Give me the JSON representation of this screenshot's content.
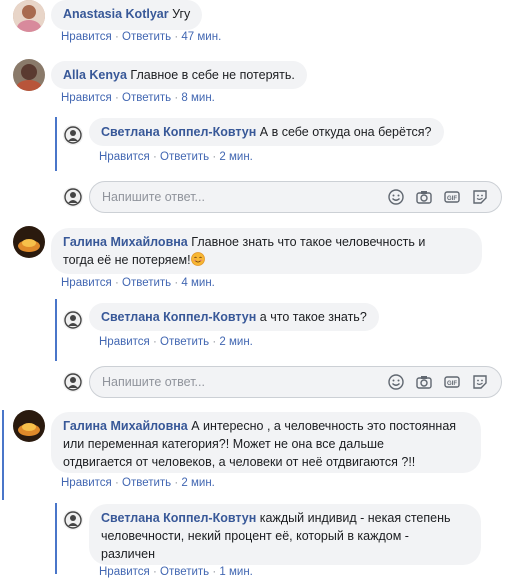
{
  "comments": [
    {
      "author": "Anastasia Kotlyar",
      "text": "Угу",
      "like": "Нравится",
      "reply": "Ответить",
      "time": "47 мин."
    },
    {
      "author": "Alla Kenya",
      "text": "Главное в себе не потерять.",
      "like": "Нравится",
      "reply": "Ответить",
      "time": "8 мин.",
      "replies": [
        {
          "author": "Светлана Коппел-Ковтун",
          "text": "А в себе откуда она берётся?",
          "like": "Нравится",
          "reply": "Ответить",
          "time": "2 мин."
        }
      ]
    },
    {
      "author": "Галина Михайловна",
      "text_line1": "Главное знать что такое человечность и",
      "text_line2": "тогда её не потеряем!",
      "like": "Нравится",
      "reply": "Ответить",
      "time": "4 мин.",
      "replies": [
        {
          "author": "Светлана Коппел-Ковтун",
          "text": "а что такое знать?",
          "like": "Нравится",
          "reply": "Ответить",
          "time": "2 мин."
        }
      ]
    },
    {
      "author": "Галина Михайловна",
      "text_line1": "А интересно , а человечность это постоянная",
      "text_line2": "или переменная категория?! Может не она все дальше",
      "text_line3": "отдвигается от человеков, а человеки от неё отдвигаются ?!!",
      "like": "Нравится",
      "reply": "Ответить",
      "time": "2 мин.",
      "replies": [
        {
          "author": "Светлана Коппел-Ковтун",
          "text_line1": "каждый индивид - некая степень",
          "text_line2": "человечности, некий процент её, который в каждом -",
          "text_line3": "различен",
          "like": "Нравится",
          "reply": "Ответить",
          "time": "1 мин."
        }
      ]
    }
  ],
  "reply_box": {
    "placeholder": "Напишите ответ..."
  },
  "separator": "·",
  "colors": {
    "author": "#385898",
    "link": "#4267b2",
    "bubble": "#f2f3f5",
    "thread_line": "#4a76c9"
  }
}
